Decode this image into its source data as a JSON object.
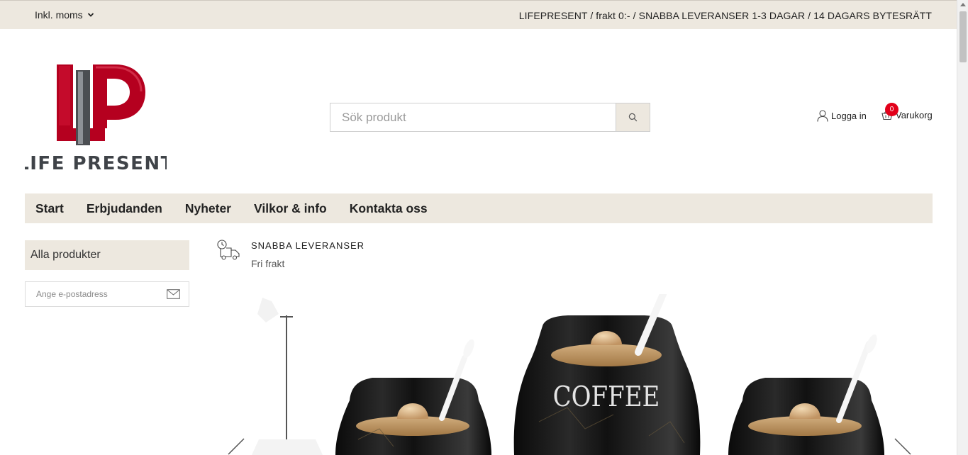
{
  "topbar": {
    "vat_label": "Inkl. moms",
    "usp_text": "LIFEPRESENT / frakt 0:- / SNABBA LEVERANSER 1-3 DAGAR / 14 DAGARS BYTESRÄTT"
  },
  "logo": {
    "monogram": "LP",
    "text": "LIFE PRESENT"
  },
  "search": {
    "placeholder": "Sök produkt"
  },
  "account": {
    "login_label": "Logga in",
    "cart_label": "Varukorg",
    "cart_count": "0"
  },
  "nav": {
    "items": [
      "Start",
      "Erbjudanden",
      "Nyheter",
      "Vilkor & info",
      "Kontakta oss"
    ]
  },
  "sidebar": {
    "all_products_label": "Alla produkter",
    "newsletter_placeholder": "Ange e-postadress"
  },
  "usp": {
    "title": "SNABBA LEVERANSER",
    "subtitle": "Fri frakt"
  },
  "hero": {
    "jar_label": "COFFEE"
  },
  "colors": {
    "beige": "#ede8df",
    "badge_red": "#e2001a",
    "logo_red": "#b5001f"
  }
}
